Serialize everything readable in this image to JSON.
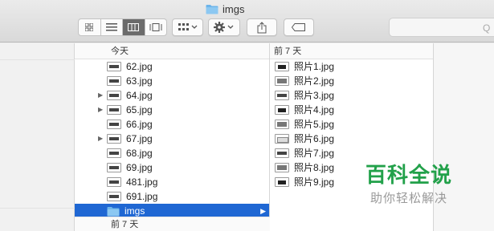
{
  "window": {
    "title": "imgs"
  },
  "toolbar": {
    "view_modes": [
      "icon-view",
      "list-view",
      "column-view",
      "gallery-view"
    ],
    "active_view": "column-view",
    "search_placeholder": "Q"
  },
  "column1": {
    "header": "今天",
    "items": [
      {
        "name": "62.jpg",
        "expandable": false
      },
      {
        "name": "63.jpg",
        "expandable": false
      },
      {
        "name": "64.jpg",
        "expandable": true
      },
      {
        "name": "65.jpg",
        "expandable": true
      },
      {
        "name": "66.jpg",
        "expandable": false
      },
      {
        "name": "67.jpg",
        "expandable": true
      },
      {
        "name": "68.jpg",
        "expandable": false
      },
      {
        "name": "69.jpg",
        "expandable": false
      },
      {
        "name": "481.jpg",
        "expandable": false
      },
      {
        "name": "691.jpg",
        "expandable": false
      },
      {
        "name": "imgs",
        "expandable": false,
        "type": "folder",
        "selected": true
      }
    ],
    "footer": "前 7 天"
  },
  "column2": {
    "header": "前 7 天",
    "items": [
      "照片1.jpg",
      "照片2.jpg",
      "照片3.jpg",
      "照片4.jpg",
      "照片5.jpg",
      "照片6.jpg",
      "照片7.jpg",
      "照片8.jpg",
      "照片9.jpg"
    ]
  },
  "watermark": {
    "title": "百科全说",
    "subtitle": "助你轻松解决"
  },
  "colors": {
    "selection": "#1f67d3",
    "folder": "#6cb4ea",
    "watermark": "#22a14a"
  }
}
